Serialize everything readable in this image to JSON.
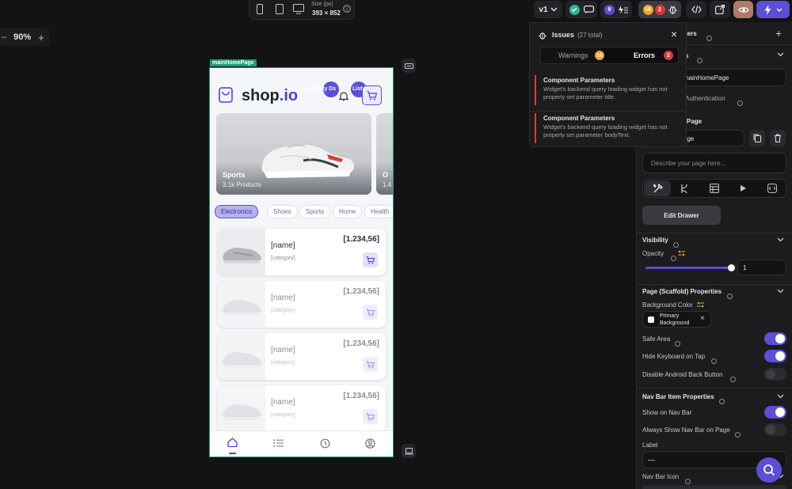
{
  "toolbar": {
    "size_label": "Size (px)",
    "size_value": "393 × 852",
    "version": "v1",
    "warnings_count": "9",
    "issues_warning_count": "16",
    "issues_error_count": "2"
  },
  "canvas": {
    "zoom": "90%",
    "page_tag": "mainHomePage"
  },
  "phone": {
    "logo_name": "shop",
    "logo_suffix": ".io",
    "overlay_activity": "Activity Ds",
    "overlay_list": "List It",
    "hero": [
      {
        "title": "Sports",
        "subtitle": "3.1k Products"
      },
      {
        "title": "O",
        "subtitle": "1.4"
      }
    ],
    "chips": [
      "Electronics",
      "Shoes",
      "Sports",
      "Home",
      "Health"
    ],
    "products": [
      {
        "name": "[name]",
        "category": "[category]",
        "price": "[1.234,56]"
      },
      {
        "name": "[name]",
        "category": "[category]",
        "price": "[1.234,56]"
      },
      {
        "name": "[name]",
        "category": "[category]",
        "price": "[1.234,56]"
      },
      {
        "name": "[name]",
        "category": "[category]",
        "price": "[1.234,56]"
      }
    ]
  },
  "issues_panel": {
    "title": "Issues",
    "total": "(27 total)",
    "tab_warnings": "Warnings",
    "tab_warnings_count": "16",
    "tab_errors": "Errors",
    "tab_errors_count": "2",
    "items": [
      {
        "title": "Component Parameters",
        "text": "Widget's backend query loading widget has not properly set parameter title."
      },
      {
        "title": "Component Parameters",
        "text": "Widget's backend query loading widget has not properly set parameter bodyText."
      }
    ]
  },
  "properties": {
    "header_suffix": "ters",
    "row2_suffix": "s",
    "page_name_value": "mainHomePage",
    "auth_label": "Authentication",
    "page_label": "Page",
    "page_type_value": "age",
    "describe_placeholder": "Describe your page here...",
    "edit_drawer": "Edit Drawer",
    "visibility": "Visibility",
    "opacity_label": "Opacity",
    "opacity_value": "1",
    "opacity_level": 1,
    "scaffold_title": "Page (Scaffold) Properties",
    "bg_color_label": "Background Color",
    "bg_color_value_line1": "Primary",
    "bg_color_value_line2": "Background",
    "safe_area": "Safe Area",
    "hide_keyboard": "Hide Keyboard on Tap",
    "disable_back": "Disable Android Back Button",
    "navbar_title": "Nav Bar Item Properties",
    "show_navbar": "Show on Nav Bar",
    "always_show_navbar": "Always Show Nav Bar on Page",
    "label_label": "Label",
    "label_value": "—",
    "navbar_icon": "Nav Bar Icon"
  },
  "colors": {
    "accent": "#5c4ed6",
    "error": "#d63a3a",
    "warning": "#f0a030",
    "success": "#2fb39a",
    "page_tag": "#1b9e73"
  }
}
